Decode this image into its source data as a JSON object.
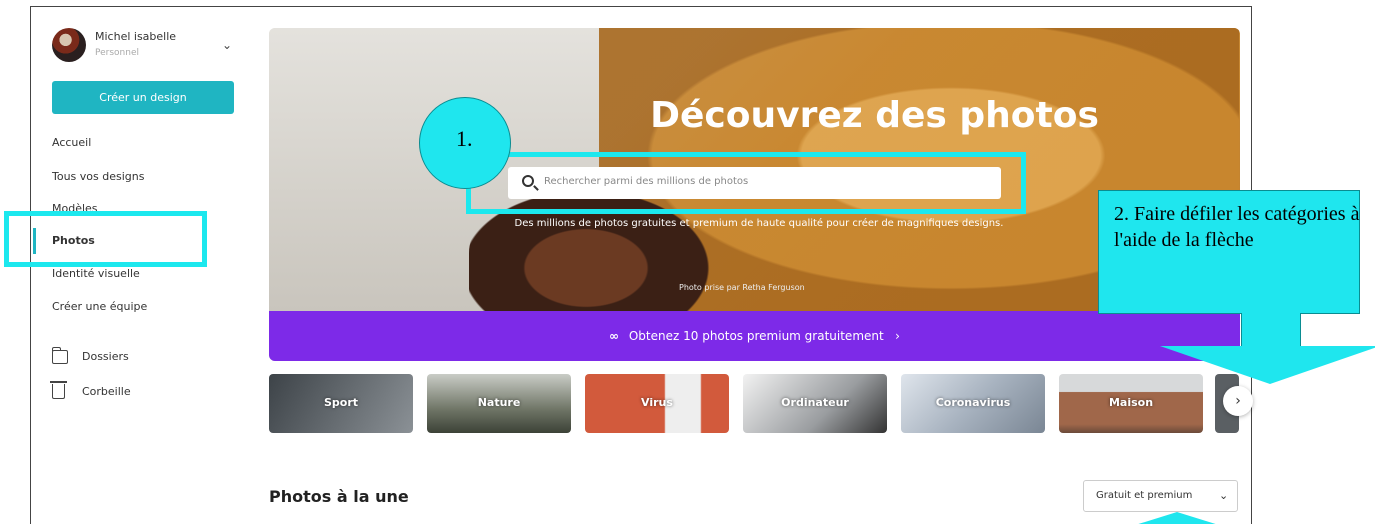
{
  "user": {
    "name": "Michel isabelle",
    "account_type": "Personnel"
  },
  "sidebar": {
    "create_button": "Créer un design",
    "nav": [
      {
        "label": "Accueil",
        "active": false
      },
      {
        "label": "Tous vos designs",
        "active": false
      },
      {
        "label": "Modèles",
        "active": false
      },
      {
        "label": "Photos",
        "active": true
      },
      {
        "label": "Identité visuelle",
        "active": false
      },
      {
        "label": "Créer une équipe",
        "active": false
      }
    ],
    "folders_label": "Dossiers",
    "trash_label": "Corbeille"
  },
  "hero": {
    "title": "Découvrez des photos",
    "search_placeholder": "Rechercher parmi des millions de photos",
    "subtitle": "Des millions de photos gratuites et premium de haute qualité pour créer de magnifiques designs.",
    "credit_prefix": "Photo prise par",
    "credit_author": "Retha Ferguson",
    "premium_banner": "Obtenez 10 photos premium gratuitement",
    "premium_icon": "infinity-icon"
  },
  "categories": [
    {
      "label": "Sport",
      "color": "#6b6f72"
    },
    {
      "label": "Nature",
      "color": "#8a8f7e"
    },
    {
      "label": "Virus",
      "color": "#d25a3c"
    },
    {
      "label": "Ordinateur",
      "color": "#9c9fa3"
    },
    {
      "label": "Coronavirus",
      "color": "#a8b3c0"
    },
    {
      "label": "Maison",
      "color": "#a0674a"
    }
  ],
  "featured": {
    "title": "Photos à la une",
    "filter_value": "Gratuit et premium"
  },
  "annotations": {
    "step1": "1.",
    "step2": "2. Faire défiler les catégories à l'aide de la flèche"
  },
  "colors": {
    "accent": "#1fb5c2",
    "premium": "#7d2ae8",
    "annotation": "#1fe6ee"
  }
}
